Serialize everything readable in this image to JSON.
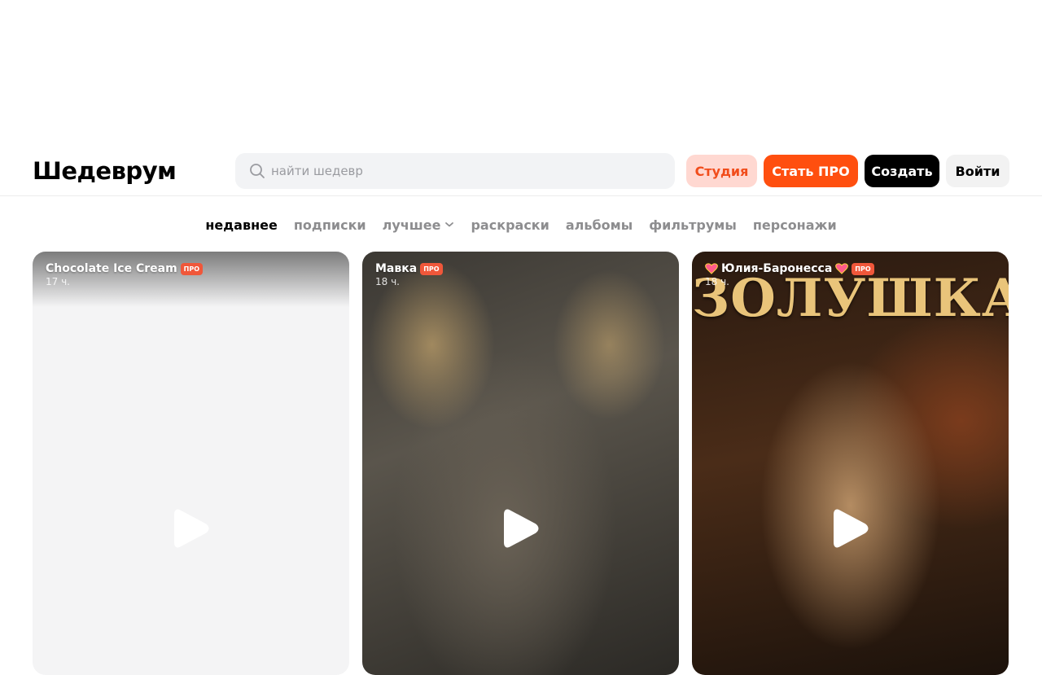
{
  "header": {
    "logo": "Шедеврум",
    "search_placeholder": "найти шедевр",
    "buttons": {
      "studio": "Студия",
      "pro": "Стать ПРО",
      "create": "Создать",
      "login": "Войти"
    }
  },
  "tabs": [
    {
      "label": "недавнее",
      "active": true
    },
    {
      "label": "подписки"
    },
    {
      "label": "лучшее"
    },
    {
      "label": "раскраски"
    },
    {
      "label": "альбомы"
    },
    {
      "label": "фильтрумы"
    },
    {
      "label": "персонажи"
    }
  ],
  "cards": [
    {
      "author": "Chocolate Ice Cream",
      "badge": "ПРО",
      "time": "17 ч."
    },
    {
      "author": "Мавка",
      "badge": "ПРО",
      "time": "18 ч."
    },
    {
      "author": "Юлия-Баронесса",
      "badge": "ПРО",
      "time": "18 ч.",
      "title": "ЗОЛУШКА"
    }
  ],
  "colors": {
    "accent": "#ff4f0f",
    "studio_bg": "#ffd8d1",
    "studio_text": "#f14d1c",
    "badge": "#f0573a"
  },
  "icons": [
    "search-icon",
    "chevron-down-icon",
    "play-icon",
    "heart-icon"
  ]
}
